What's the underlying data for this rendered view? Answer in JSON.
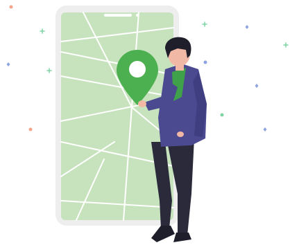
{
  "illustration": {
    "icon": "location-pin-icon",
    "colors": {
      "background": "#ffffff",
      "phone_frame": "#eeeeee",
      "map_fill": "#c7e3bd",
      "map_roads": "#ffffff",
      "pin": "#4caf50",
      "pin_dot": "#ffffff",
      "jacket": "#4b4a90",
      "shirt": "#3fa14a",
      "pants": "#2a2a3a",
      "skin": "#f2b8a6",
      "hair": "#1f1f2b",
      "shoes": "#1f1f2b",
      "sparkle_green": "#7fd3a3",
      "sparkle_blue": "#8ea4e0",
      "sparkle_orange": "#f4a58a"
    }
  }
}
